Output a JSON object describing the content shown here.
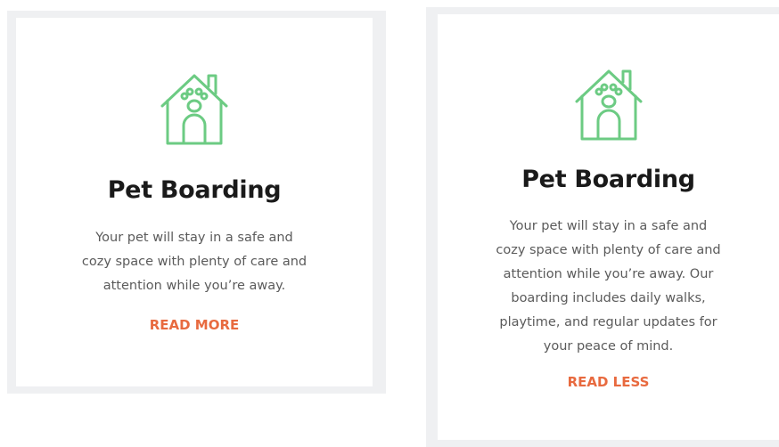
{
  "colors": {
    "frame": "#eff0f2",
    "card": "#ffffff",
    "icon": "#6ccb83",
    "title": "#1a1a1a",
    "text": "#5b5b5b",
    "link": "#e86a3f"
  },
  "cards": [
    {
      "icon": "dog-house-paw-icon",
      "title": "Pet Boarding",
      "description_lines": [
        "Your pet will stay in a safe and",
        "cozy space with plenty of care and",
        "attention while you’re away."
      ],
      "link_label": "READ MORE"
    },
    {
      "icon": "dog-house-paw-icon",
      "title": "Pet Boarding",
      "description_lines": [
        "Your pet will stay in a safe and",
        "cozy space with plenty of care and",
        "attention while you’re away. Our",
        "boarding includes daily walks,",
        "playtime, and regular updates for",
        "your peace of mind."
      ],
      "link_label": "READ LESS"
    }
  ]
}
